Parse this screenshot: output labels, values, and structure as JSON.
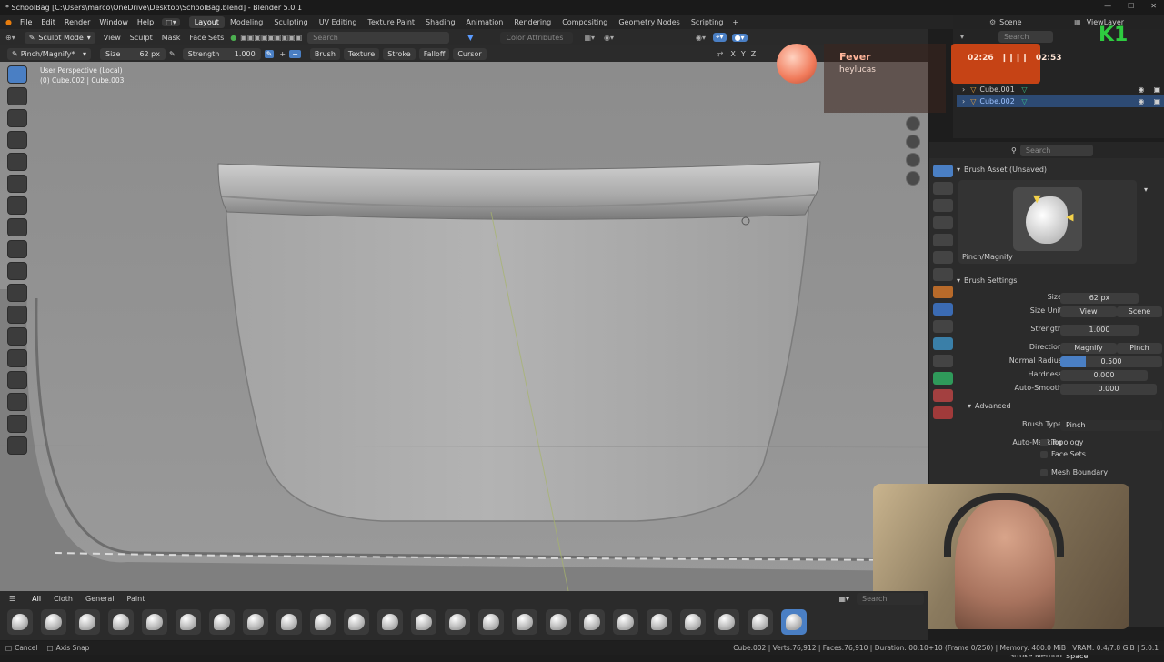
{
  "window": {
    "title": "* SchoolBag [C:\\Users\\marco\\OneDrive\\Desktop\\SchoolBag.blend] - Blender 5.0.1"
  },
  "menu": {
    "items": [
      "File",
      "Edit",
      "Render",
      "Window",
      "Help"
    ]
  },
  "workspaces": [
    "Layout",
    "Modeling",
    "Sculpting",
    "UV Editing",
    "Texture Paint",
    "Shading",
    "Animation",
    "Rendering",
    "Compositing",
    "Geometry Nodes",
    "Scripting"
  ],
  "active_workspace": "Layout",
  "header": {
    "mode": "Sculpt Mode",
    "menus": [
      "View",
      "Sculpt",
      "Mask",
      "Face Sets"
    ],
    "search_placeholder": "Search",
    "color_attributes": "Color Attributes",
    "axes": [
      "X",
      "Y",
      "Z"
    ]
  },
  "tool_header": {
    "brush_name": "Pinch/Magnify*",
    "size_label": "Size",
    "size_value": "62 px",
    "strength_label": "Strength",
    "strength_value": "1.000",
    "menus": [
      "Brush",
      "Texture",
      "Stroke",
      "Falloff",
      "Cursor"
    ]
  },
  "viewport": {
    "perspective": "User Perspective (Local)",
    "object": "(0) Cube.002 | Cube.003"
  },
  "overlay": {
    "fever_title": "Fever",
    "fever_artist": "heylucas",
    "time_elapsed": "02:26",
    "time_total": "02:53",
    "channel_logo": "K1"
  },
  "outliner": {
    "scene": "Scene",
    "view_layer": "ViewLayer",
    "search_placeholder": "Search",
    "objects": [
      "Cube.001",
      "Cube.002"
    ]
  },
  "properties": {
    "search_placeholder": "Search",
    "brush_asset_header": "Brush Asset (Unsaved)",
    "brush_asset_name": "Pinch/Magnify",
    "brush_settings_header": "Brush Settings",
    "size_label": "Size",
    "size_value": "62 px",
    "size_unit_label": "Size Unit",
    "size_unit_view": "View",
    "size_unit_scene": "Scene",
    "strength_label": "Strength",
    "strength_value": "1.000",
    "direction_label": "Direction",
    "direction_magnify": "Magnify",
    "direction_pinch": "Pinch",
    "normal_radius_label": "Normal Radius",
    "normal_radius_value": "0.500",
    "hardness_label": "Hardness",
    "hardness_value": "0.000",
    "auto_smooth_label": "Auto-Smooth",
    "auto_smooth_value": "0.000",
    "advanced_header": "Advanced",
    "brush_type_label": "Brush Type",
    "brush_type_value": "Pinch",
    "auto_masking_label": "Auto-Masking",
    "masking_options": [
      "Topology",
      "Face Sets",
      "Mesh Boundary"
    ],
    "stroke_method_label": "Stroke Method",
    "stroke_method_value": "Space"
  },
  "asset_shelf": {
    "tabs": [
      "All",
      "Cloth",
      "General",
      "Paint"
    ],
    "search_placeholder": "Search"
  },
  "status": {
    "left_cancel": "Cancel",
    "left_axis": "Axis Snap",
    "right": "Cube.002 | Verts:76,912 | Faces:76,910 | Duration: 00:10+10 (Frame 0/250) | Memory: 400.0 MiB | VRAM: 0.4/7.8 GiB | 5.0.1"
  },
  "colors": {
    "accent": "#4a7fc4",
    "music_widget": "#c64315",
    "logo_green": "#2ecc40"
  }
}
